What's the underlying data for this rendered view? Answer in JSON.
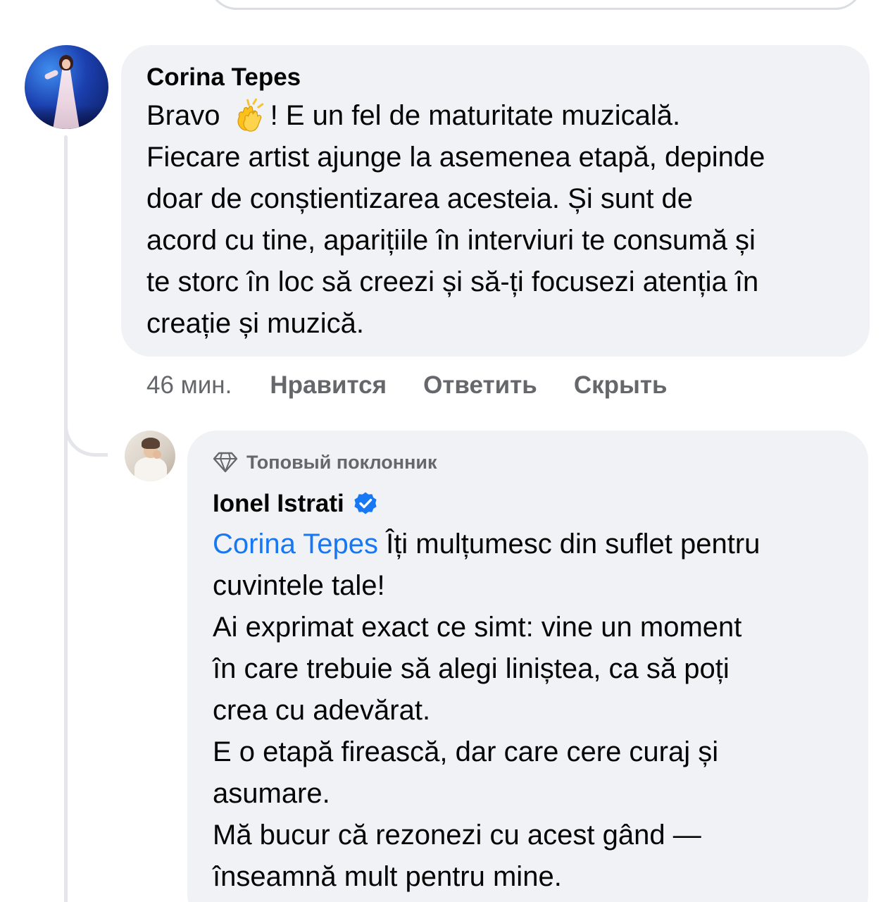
{
  "comment": {
    "author": "Corina Tepes",
    "text_before_emoji": "Bravo ",
    "emoji": "clapping-hands",
    "lines": [
      "! E un fel de maturitate muzicală.",
      "Fiecare artist ajunge la asemenea etapă, depinde",
      "doar de conștientizarea acesteia. Și sunt de",
      "acord cu tine, aparițiile în interviuri te consumă și",
      "te storc în loc să creezi și să-ți focusezi atenția în",
      "creație și muzică."
    ],
    "time": "46 мин.",
    "like_label": "Нравится",
    "reply_label": "Ответить",
    "hide_label": "Скрыть"
  },
  "reply": {
    "badge": "Топовый поклонник",
    "author": "Ionel Istrati",
    "verified": true,
    "mention": "Corina Tepes",
    "first_line_rest": " Îți mulțumesc din suflet pentru",
    "lines": [
      "cuvintele tale!",
      "Ai exprimat exact ce simt: vine un moment",
      "în care trebuie să alegi liniștea, ca să poți",
      "crea cu adevărat.",
      "E o etapă firească, dar care cere curaj și",
      "asumare.",
      "Mă bucur că rezonezi cu acest gând —",
      "înseamnă mult pentru mine."
    ]
  },
  "colors": {
    "bubble": "#f0f2f5",
    "secondary_text": "#65676b",
    "link": "#1877f2",
    "verified": "#1877f2"
  }
}
